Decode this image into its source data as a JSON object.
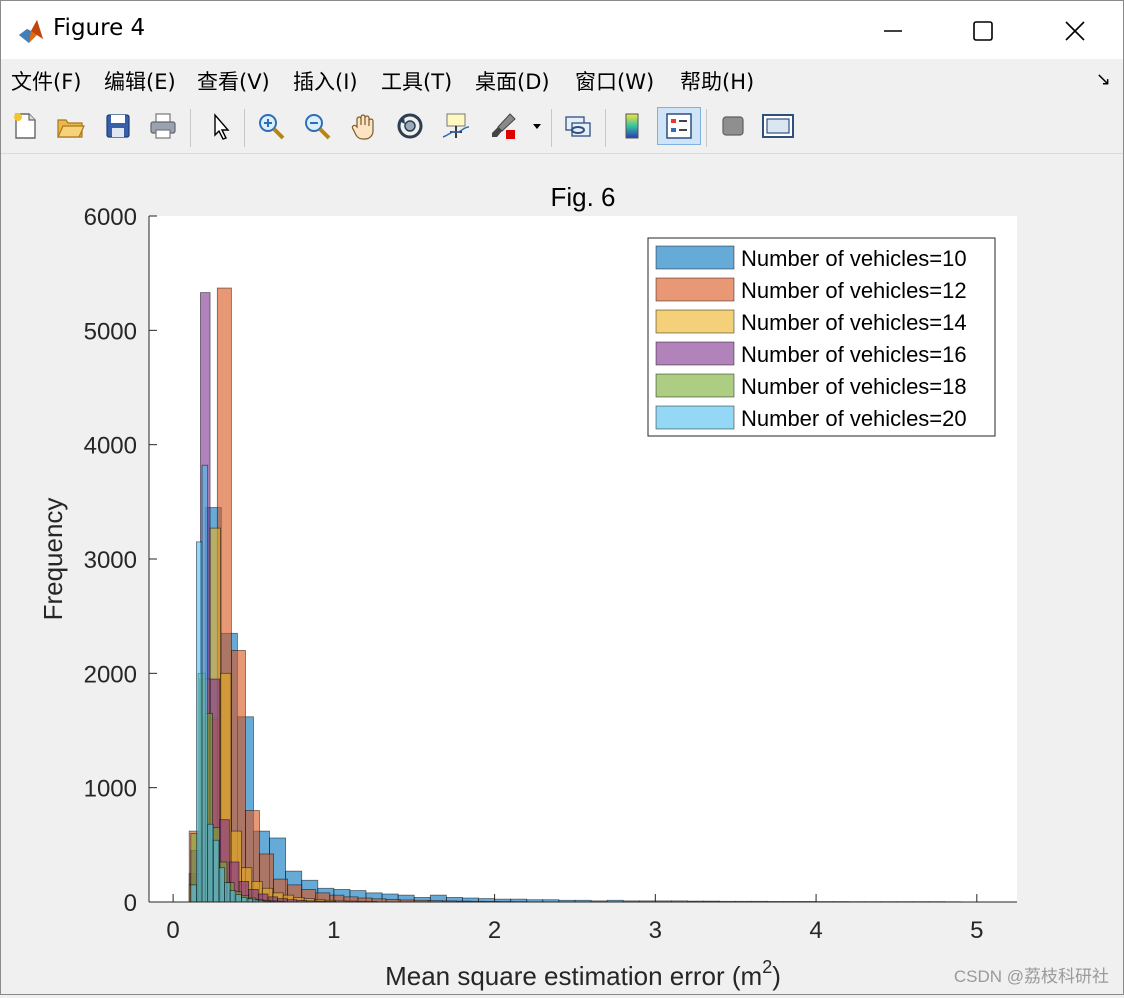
{
  "window": {
    "title": "Figure 4",
    "controls": {
      "minimize": "minimize",
      "maximize": "maximize",
      "close": "close"
    }
  },
  "menu": {
    "items": [
      "文件(F)",
      "编辑(E)",
      "查看(V)",
      "插入(I)",
      "工具(T)",
      "桌面(D)",
      "窗口(W)",
      "帮助(H)"
    ]
  },
  "toolbar": {
    "icons": [
      "new-figure-icon",
      "open-folder-icon",
      "save-icon",
      "print-icon",
      "pointer-icon",
      "zoom-in-icon",
      "zoom-out-icon",
      "pan-hand-icon",
      "rotate-3d-icon",
      "data-cursor-icon",
      "brush-icon",
      "link-plot-icon",
      "colorbar-icon",
      "legend-icon",
      "hide-tools-icon",
      "show-tools-icon"
    ]
  },
  "watermark": "CSDN @荔枝科研社",
  "chart_data": {
    "type": "bar",
    "subtype": "overlaid-histogram",
    "title": "Fig. 6",
    "xlabel": "Mean square estimation error (m",
    "xlabel_sup": "2",
    "xlabel_close": ")",
    "ylabel": "Frequency",
    "xlim": [
      -0.15,
      5.25
    ],
    "ylim": [
      0,
      6000
    ],
    "xticks": [
      "0",
      "1",
      "2",
      "3",
      "4",
      "5"
    ],
    "yticks": [
      "0",
      "1000",
      "2000",
      "3000",
      "4000",
      "5000",
      "6000"
    ],
    "grid": false,
    "legend_position": "top-right",
    "series": [
      {
        "name": "Number of vehicles=10",
        "color": "#0072BD",
        "bin_start": 0.1,
        "bin_width": 0.1,
        "values": [
          250,
          3450,
          2350,
          1620,
          620,
          560,
          270,
          190,
          120,
          110,
          100,
          80,
          70,
          60,
          40,
          60,
          40,
          35,
          30,
          25,
          25,
          20,
          20,
          15,
          15,
          10,
          15,
          10,
          10,
          10,
          10,
          8,
          8,
          6,
          6,
          6,
          5,
          5,
          5,
          4,
          4,
          3,
          3,
          3,
          3,
          3,
          3,
          2
        ]
      },
      {
        "name": "Number of vehicles=12",
        "color": "#D95319",
        "bin_start": 0.1,
        "bin_width": 0.0875,
        "values": [
          620,
          1600,
          5370,
          2200,
          800,
          420,
          200,
          150,
          110,
          80,
          60,
          45,
          35,
          28,
          22,
          18,
          15,
          12,
          10,
          8,
          6,
          5,
          4,
          3
        ]
      },
      {
        "name": "Number of vehicles=14",
        "color": "#EDB120",
        "bin_start": 0.1,
        "bin_width": 0.065,
        "values": [
          150,
          1950,
          3270,
          2000,
          620,
          300,
          180,
          120,
          80,
          60,
          40,
          30,
          20,
          15,
          10,
          8,
          6,
          5
        ]
      },
      {
        "name": "Number of vehicles=16",
        "color": "#7E2F8E",
        "bin_start": 0.11,
        "bin_width": 0.06,
        "values": [
          450,
          5330,
          1950,
          720,
          350,
          180,
          110,
          70,
          45,
          30,
          20,
          14,
          10,
          7,
          5
        ]
      },
      {
        "name": "Number of vehicles=18",
        "color": "#77AC30",
        "bin_start": 0.11,
        "bin_width": 0.045,
        "values": [
          600,
          2000,
          1650,
          650,
          350,
          170,
          90,
          55,
          35,
          22,
          15,
          10,
          7
        ]
      },
      {
        "name": "Number of vehicles=20",
        "color": "#4DBEEE",
        "bin_start": 0.11,
        "bin_width": 0.035,
        "values": [
          150,
          3150,
          3820,
          680,
          540,
          300,
          170,
          100,
          65,
          40,
          28,
          18,
          12,
          8,
          5
        ]
      }
    ]
  }
}
